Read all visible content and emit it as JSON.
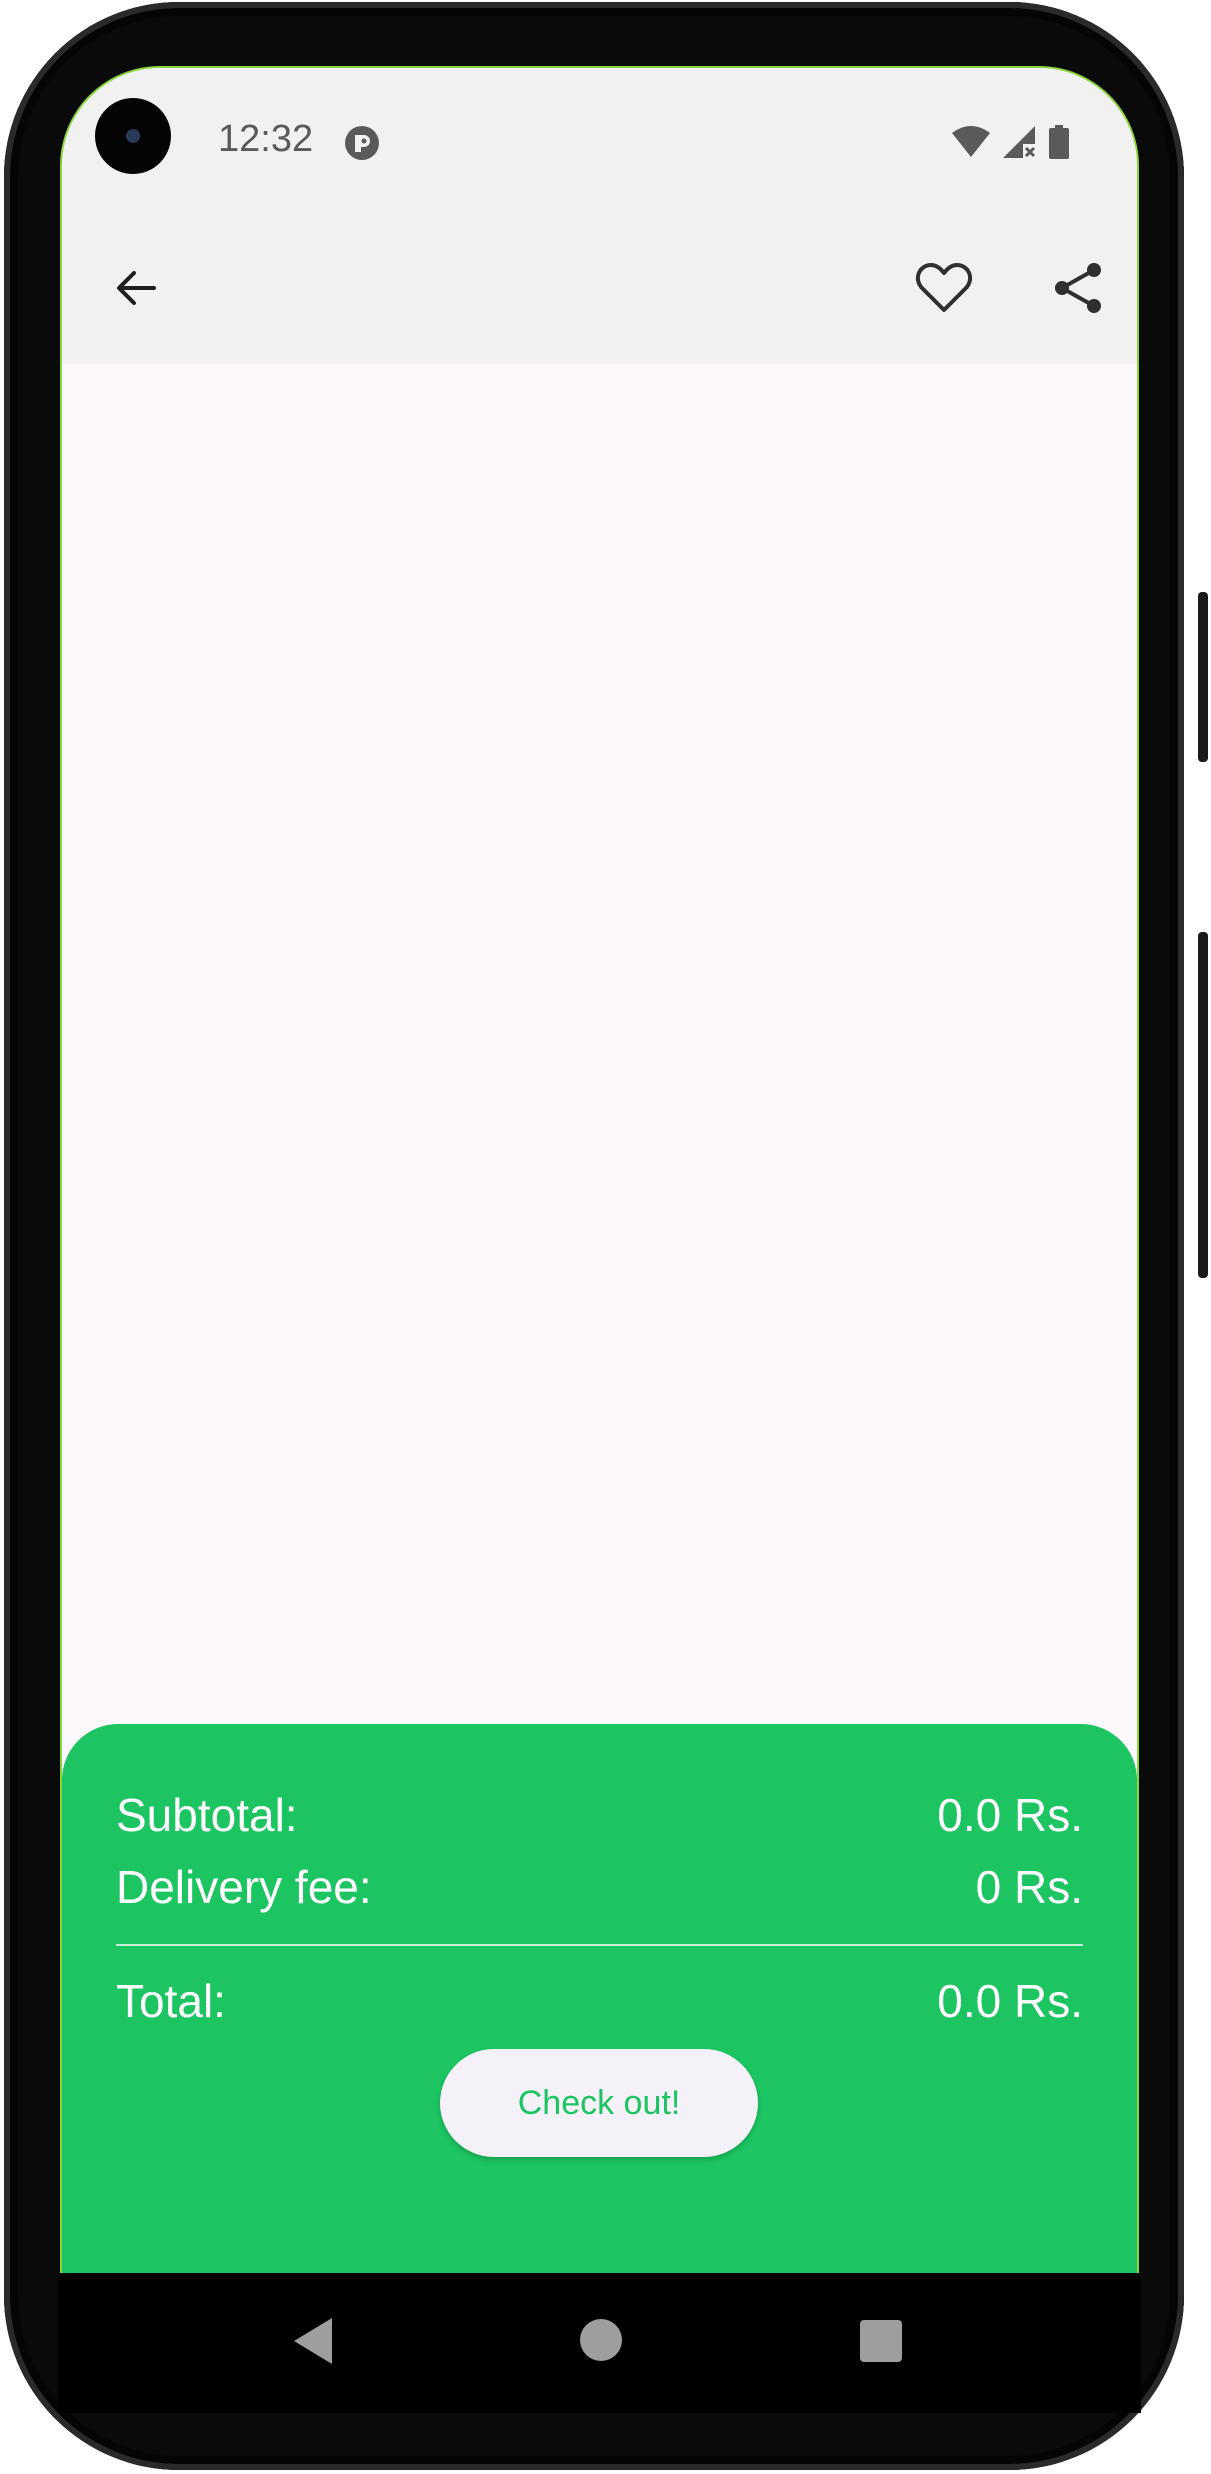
{
  "status_bar": {
    "time": "12:32",
    "icons": [
      "app-notification-icon",
      "wifi-icon",
      "signal-icon",
      "battery-icon"
    ]
  },
  "top_bar": {
    "icons": [
      "back-arrow-icon",
      "heart-icon",
      "share-icon"
    ]
  },
  "summary": {
    "subtotal_label": "Subtotal:",
    "subtotal_value": "0.0 Rs.",
    "delivery_label": "Delivery fee:",
    "delivery_value": "0 Rs.",
    "total_label": "Total:",
    "total_value": "0.0 Rs.",
    "checkout_label": "Check out!"
  },
  "nav_bar": {
    "icons": [
      "nav-back-icon",
      "nav-home-icon",
      "nav-recents-icon"
    ]
  },
  "colors": {
    "accent": "#1cc561",
    "app_bar": "#f0f1f0",
    "background": "#fdf8fb",
    "button_bg": "#f5f1f8"
  }
}
